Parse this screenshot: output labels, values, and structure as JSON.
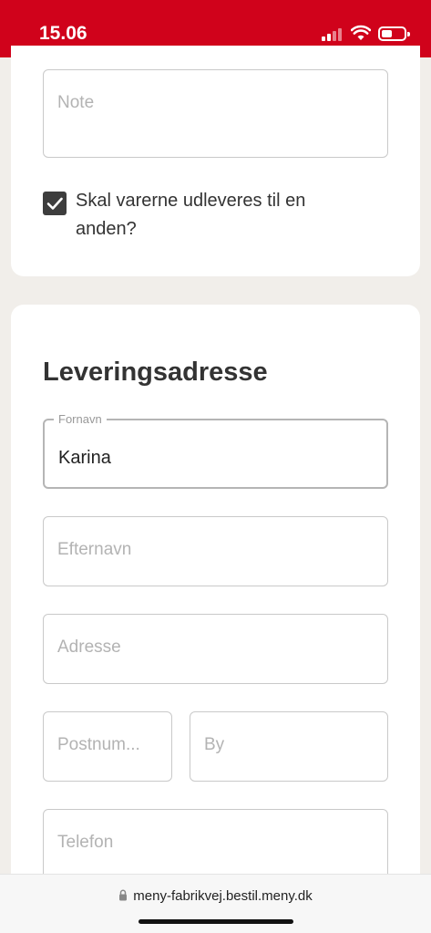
{
  "status_bar": {
    "time": "15.06",
    "background_color": "#d0021b"
  },
  "form_top": {
    "note_placeholder": "Note",
    "checkbox_checked": true,
    "checkbox_label": "Skal varerne udleveres til en anden?"
  },
  "delivery": {
    "title": "Leveringsadresse",
    "first_name_label": "Fornavn",
    "first_name_value": "Karina",
    "last_name_placeholder": "Efternavn",
    "address_placeholder": "Adresse",
    "postal_placeholder": "Postnum...",
    "city_placeholder": "By",
    "phone_placeholder": "Telefon"
  },
  "browser": {
    "url": "meny-fabrikvej.bestil.meny.dk",
    "lock_icon": "lock-icon"
  }
}
